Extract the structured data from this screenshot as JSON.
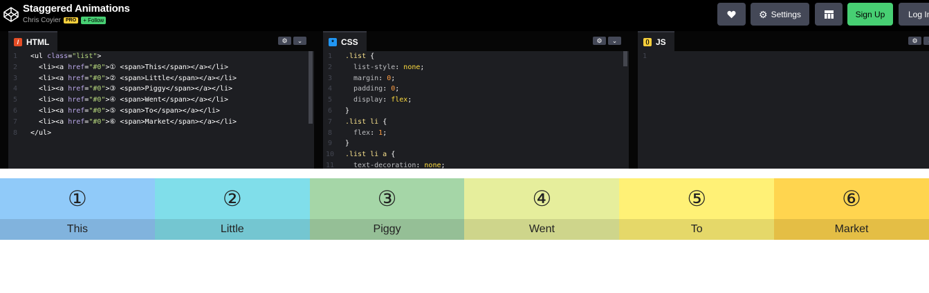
{
  "header": {
    "title": "Staggered Animations",
    "author": "Chris Coyier",
    "pro_badge": "PRO",
    "follow_label": "+ Follow",
    "settings_label": "Settings",
    "signup_label": "Sign Up",
    "login_label": "Log In"
  },
  "panes": {
    "html": {
      "label": "HTML",
      "icon": "html-icon"
    },
    "css": {
      "label": "CSS",
      "icon": "css-icon"
    },
    "js": {
      "label": "JS",
      "icon": "js-icon"
    }
  },
  "html_code": [
    [
      [
        "<ul ",
        "#fff"
      ],
      [
        "class",
        "#bba8ea"
      ],
      [
        "=",
        "#fff"
      ],
      [
        "\"list\"",
        "#b6d77d"
      ],
      [
        ">",
        "#fff"
      ]
    ],
    [
      [
        "  <li>",
        "#fff"
      ],
      [
        "<a ",
        "#fff"
      ],
      [
        "href",
        "#bba8ea"
      ],
      [
        "=",
        "#fff"
      ],
      [
        "\"#0\"",
        "#b6d77d"
      ],
      [
        ">① ",
        "#fff"
      ],
      [
        "<span>",
        "#fff"
      ],
      [
        "This",
        "#fff"
      ],
      [
        "</span></a></li>",
        "#fff"
      ]
    ],
    [
      [
        "  <li>",
        "#fff"
      ],
      [
        "<a ",
        "#fff"
      ],
      [
        "href",
        "#bba8ea"
      ],
      [
        "=",
        "#fff"
      ],
      [
        "\"#0\"",
        "#b6d77d"
      ],
      [
        ">② ",
        "#fff"
      ],
      [
        "<span>",
        "#fff"
      ],
      [
        "Little",
        "#fff"
      ],
      [
        "</span></a></li>",
        "#fff"
      ]
    ],
    [
      [
        "  <li>",
        "#fff"
      ],
      [
        "<a ",
        "#fff"
      ],
      [
        "href",
        "#bba8ea"
      ],
      [
        "=",
        "#fff"
      ],
      [
        "\"#0\"",
        "#b6d77d"
      ],
      [
        ">③ ",
        "#fff"
      ],
      [
        "<span>",
        "#fff"
      ],
      [
        "Piggy",
        "#fff"
      ],
      [
        "</span></a></li>",
        "#fff"
      ]
    ],
    [
      [
        "  <li>",
        "#fff"
      ],
      [
        "<a ",
        "#fff"
      ],
      [
        "href",
        "#bba8ea"
      ],
      [
        "=",
        "#fff"
      ],
      [
        "\"#0\"",
        "#b6d77d"
      ],
      [
        ">④ ",
        "#fff"
      ],
      [
        "<span>",
        "#fff"
      ],
      [
        "Went",
        "#fff"
      ],
      [
        "</span></a></li>",
        "#fff"
      ]
    ],
    [
      [
        "  <li>",
        "#fff"
      ],
      [
        "<a ",
        "#fff"
      ],
      [
        "href",
        "#bba8ea"
      ],
      [
        "=",
        "#fff"
      ],
      [
        "\"#0\"",
        "#b6d77d"
      ],
      [
        ">⑤ ",
        "#fff"
      ],
      [
        "<span>",
        "#fff"
      ],
      [
        "To",
        "#fff"
      ],
      [
        "</span></a></li>",
        "#fff"
      ]
    ],
    [
      [
        "  <li>",
        "#fff"
      ],
      [
        "<a ",
        "#fff"
      ],
      [
        "href",
        "#bba8ea"
      ],
      [
        "=",
        "#fff"
      ],
      [
        "\"#0\"",
        "#b6d77d"
      ],
      [
        ">⑥ ",
        "#fff"
      ],
      [
        "<span>",
        "#fff"
      ],
      [
        "Market",
        "#fff"
      ],
      [
        "</span></a></li>",
        "#fff"
      ]
    ],
    [
      [
        "</ul>",
        "#fff"
      ]
    ]
  ],
  "css_code": [
    [
      [
        ".list ",
        "#f7e08c"
      ],
      [
        "{",
        "#fff"
      ]
    ],
    [
      [
        "  list-style",
        "#bdbec1"
      ],
      [
        ": ",
        "#fff"
      ],
      [
        "none",
        "#ffdd40"
      ],
      [
        ";",
        "#fff"
      ]
    ],
    [
      [
        "  margin",
        "#bdbec1"
      ],
      [
        ": ",
        "#fff"
      ],
      [
        "0",
        "#ff9e44"
      ],
      [
        ";",
        "#fff"
      ]
    ],
    [
      [
        "  padding",
        "#bdbec1"
      ],
      [
        ": ",
        "#fff"
      ],
      [
        "0",
        "#ff9e44"
      ],
      [
        ";",
        "#fff"
      ]
    ],
    [
      [
        "  display",
        "#bdbec1"
      ],
      [
        ": ",
        "#fff"
      ],
      [
        "flex",
        "#ffdd40"
      ],
      [
        ";",
        "#fff"
      ]
    ],
    [
      [
        "}",
        "#fff"
      ]
    ],
    [
      [
        ".list li ",
        "#f7e08c"
      ],
      [
        "{",
        "#fff"
      ]
    ],
    [
      [
        "  flex",
        "#bdbec1"
      ],
      [
        ": ",
        "#fff"
      ],
      [
        "1",
        "#ff9e44"
      ],
      [
        ";",
        "#fff"
      ]
    ],
    [
      [
        "}",
        "#fff"
      ]
    ],
    [
      [
        ".list li a ",
        "#f7e08c"
      ],
      [
        "{",
        "#fff"
      ]
    ],
    [
      [
        "  text-decoration",
        "#bdbec1"
      ],
      [
        ": ",
        "#fff"
      ],
      [
        "none",
        "#ffdd40"
      ],
      [
        ";",
        "#fff"
      ]
    ]
  ],
  "js_code": [
    []
  ],
  "result_items": [
    {
      "num": "①",
      "word": "This",
      "top": "#90caf9",
      "bottom": "#81b3dd"
    },
    {
      "num": "②",
      "word": "Little",
      "top": "#80deea",
      "bottom": "#74c6d1"
    },
    {
      "num": "③",
      "word": "Piggy",
      "top": "#a5d6a7",
      "bottom": "#95bf96"
    },
    {
      "num": "④",
      "word": "Went",
      "top": "#e6ee9c",
      "bottom": "#ced58b"
    },
    {
      "num": "⑤",
      "word": "To",
      "top": "#fff176",
      "bottom": "#e5d869"
    },
    {
      "num": "⑥",
      "word": "Market",
      "top": "#ffd54f",
      "bottom": "#e4be45"
    }
  ],
  "colors": {
    "signup": "#47cf73",
    "accent_html": "#e44d26",
    "accent_css": "#2196f3",
    "accent_js": "#f7cf3c"
  }
}
